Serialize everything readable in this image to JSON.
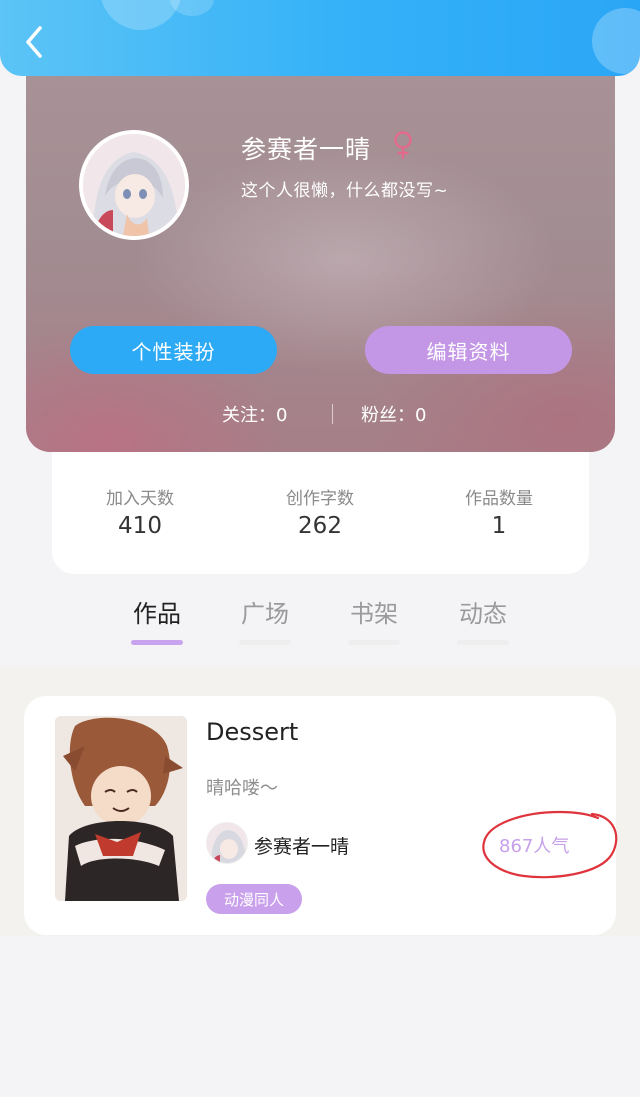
{
  "header": {
    "back_icon": "chevron-left-icon"
  },
  "profile": {
    "nickname": "参赛者一晴",
    "gender_icon": "female-icon",
    "bio": "这个人很懒，什么都没写~",
    "buttons": {
      "style_label": "个性装扮",
      "edit_label": "编辑资料"
    },
    "following": "关注：0",
    "fans": "粉丝：0"
  },
  "stats": [
    {
      "label": "加入天数",
      "value": "410"
    },
    {
      "label": "创作字数",
      "value": "262"
    },
    {
      "label": "作品数量",
      "value": "1"
    }
  ],
  "tabs": [
    {
      "label": "作品",
      "active": true
    },
    {
      "label": "广场",
      "active": false
    },
    {
      "label": "书架",
      "active": false
    },
    {
      "label": "动态",
      "active": false
    }
  ],
  "works": [
    {
      "title": "Dessert",
      "description": "晴哈喽～",
      "author": "参赛者一晴",
      "popularity": "867人气",
      "tag": "动漫同人"
    }
  ],
  "colors": {
    "header_blue": "#34b1f8",
    "button_blue": "#2daaf5",
    "button_purple": "#c497e6",
    "accent_purple": "#c9a4ee",
    "annotation_red": "#e0343c"
  }
}
